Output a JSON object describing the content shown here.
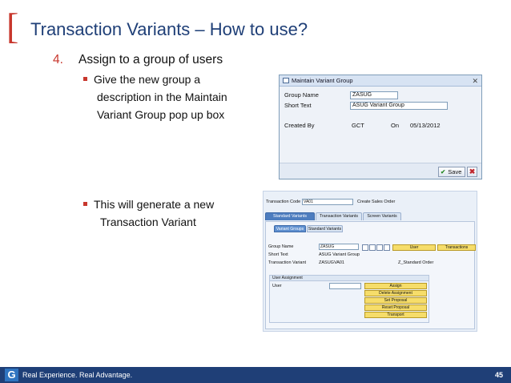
{
  "slide": {
    "title": "Transaction Variants – How to use?",
    "step_number": "4.",
    "step_text": "Assign to a group of users",
    "bullet1_line1": "Give the new group a",
    "bullet1_line2": "description in the Maintain",
    "bullet1_line3": "Variant Group pop up box",
    "bullet2_line1": "This will generate a new",
    "bullet2_line2": "Transaction Variant"
  },
  "dialog": {
    "title": "Maintain Variant Group",
    "group_name_label": "Group Name",
    "group_name_value": "ZASUG",
    "short_text_label": "Short Text",
    "short_text_value": "ASUG Variant Group",
    "created_by_label": "Created By",
    "created_by_value": "GCT",
    "on_label": "On",
    "date_value": "05/13/2012",
    "save_label": "Save"
  },
  "screen": {
    "tcode_label": "Transaction Code",
    "tcode_value": "VA01",
    "tcode_desc": "Create Sales Order",
    "tabs": [
      "Standard Variants",
      "Transaction Variants",
      "Screen Variants"
    ],
    "subtabs": [
      "Variant Groups",
      "Standard Variants"
    ],
    "group_name_label": "Group Name",
    "group_name_value": "ZASUG",
    "short_text_label": "Short Text",
    "short_text_value": "ASUG Variant Group",
    "tv_label": "Transaction Variant",
    "tv_value": "ZASUGVA01",
    "tv_desc": "Z_Standard Order",
    "user_btn": "User",
    "transactions_btn": "Transactions",
    "user_assignment": "User Assignment",
    "user_label": "User",
    "assign": "Assign",
    "delete_assignment": "Delete Assignment",
    "set_proposal": "Set Proposal",
    "reset_proposal": "Reset Proposal",
    "transport": "Transport"
  },
  "footer": {
    "logo_letter": "G",
    "tagline": "Real Experience. Real Advantage.",
    "page_number": "45"
  },
  "colors": {
    "accent_red": "#c8372d",
    "title_blue": "#1f3f77",
    "footer_blue": "#1f3f77"
  }
}
